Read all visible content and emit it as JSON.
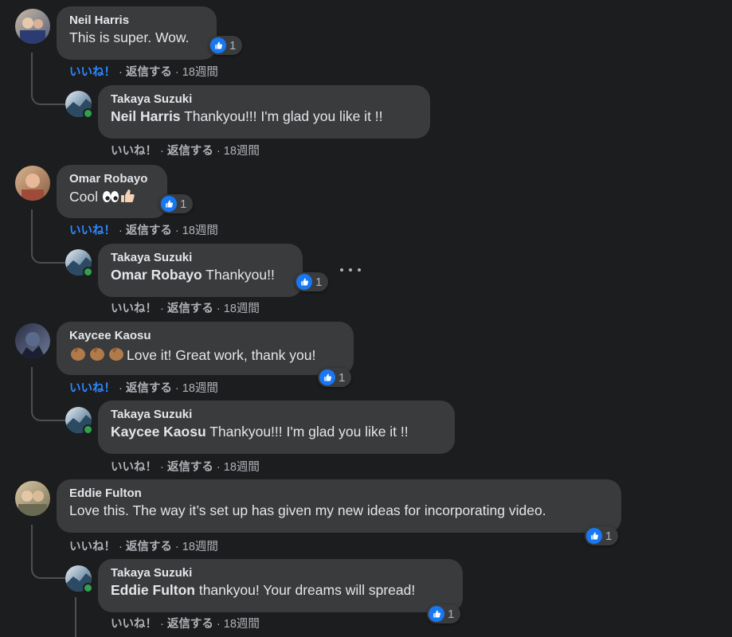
{
  "comments": [
    {
      "author": "Neil Harris",
      "text": "This is super. Wow.",
      "reaction_count": "1",
      "like_label": "いいね！",
      "reply_label": "返信する",
      "time": "18週間",
      "reply": {
        "author": "Takaya Suzuki",
        "mention": "Neil Harris",
        "text": " Thankyou!!! I'm glad you like it !!",
        "like_label": "いいね！",
        "reply_label": "返信する",
        "time": "18週間"
      }
    },
    {
      "author": "Omar Robayo",
      "text": "Cool ",
      "reaction_count": "1",
      "like_label": "いいね！",
      "reply_label": "返信する",
      "time": "18週間",
      "reply": {
        "author": "Takaya Suzuki",
        "mention": "Omar Robayo",
        "text": " Thankyou!!",
        "reaction_count": "1",
        "like_label": "いいね！",
        "reply_label": "返信する",
        "time": "18週間"
      }
    },
    {
      "author": "Kaycee Kaosu",
      "text": "Love it! Great work, thank you!",
      "reaction_count": "1",
      "like_label": "いいね！",
      "reply_label": "返信する",
      "time": "18週間",
      "reply": {
        "author": "Takaya Suzuki",
        "mention": "Kaycee Kaosu",
        "text": " Thankyou!!! I'm glad you like it !!",
        "like_label": "いいね！",
        "reply_label": "返信する",
        "time": "18週間"
      }
    },
    {
      "author": "Eddie Fulton",
      "text": "Love this. The way it’s set up has given my new ideas for incorporating video.",
      "reaction_count": "1",
      "like_label": "いいね！",
      "reply_label": "返信する",
      "time": "18週間",
      "reply": {
        "author": "Takaya Suzuki",
        "mention": "Eddie Fulton",
        "text": " thankyou! Your dreams will spread!",
        "reaction_count": "1",
        "like_label": "いいね！",
        "reply_label": "返信する",
        "time": "18週間"
      }
    }
  ],
  "separator": " · ",
  "colors": {
    "background": "#1c1d1f",
    "bubble": "#3a3b3c",
    "liked": "#2e89ff",
    "secondary_text": "#b0b3b8",
    "like_badge": "#1877f2",
    "online": "#31a24c"
  },
  "icons": [
    "like-thumb-icon",
    "more-options-icon",
    "online-status-icon"
  ]
}
